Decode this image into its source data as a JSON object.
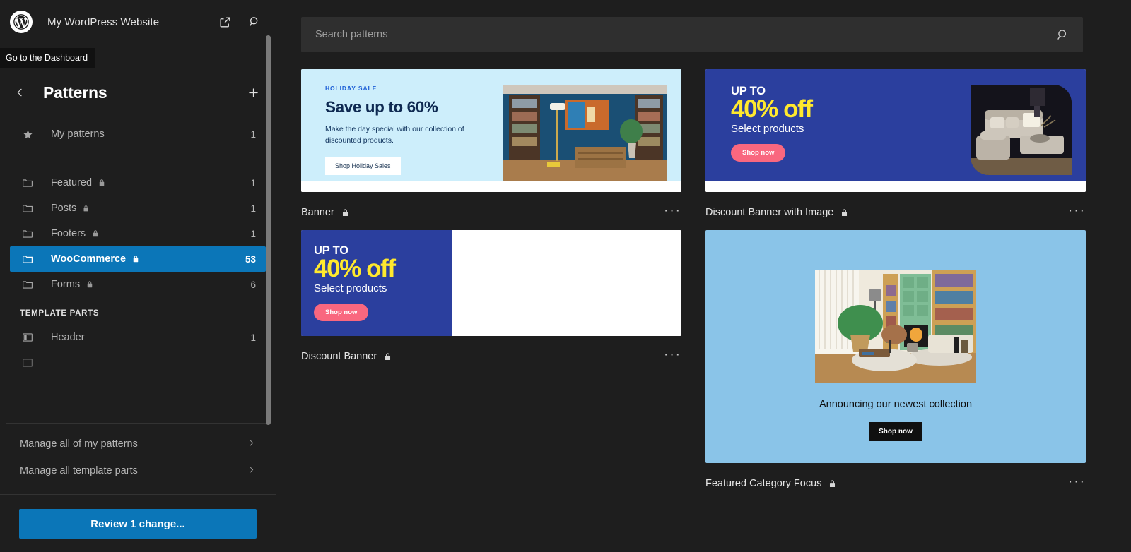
{
  "sidebar": {
    "site_title": "My WordPress Website",
    "logo_icon": "wordpress-logo-icon",
    "view_site_icon": "external-link-icon",
    "search_icon": "search-icon",
    "tooltip": "Go to the Dashboard",
    "panel_title": "Patterns",
    "back_icon": "chevron-left-icon",
    "add_icon": "plus-icon",
    "my_patterns": {
      "label": "My patterns",
      "count": "1",
      "icon": "star-icon"
    },
    "categories": [
      {
        "label": "Featured",
        "count": "1",
        "icon": "folder-icon",
        "locked": true
      },
      {
        "label": "Posts",
        "count": "1",
        "icon": "folder-icon",
        "locked": true
      },
      {
        "label": "Footers",
        "count": "1",
        "icon": "folder-icon",
        "locked": true
      },
      {
        "label": "WooCommerce",
        "count": "53",
        "icon": "folder-icon",
        "locked": true,
        "selected": true
      },
      {
        "label": "Forms",
        "count": "6",
        "icon": "folder-icon",
        "locked": true
      }
    ],
    "template_parts_label": "TEMPLATE PARTS",
    "template_parts": [
      {
        "label": "Header",
        "count": "1",
        "icon": "template-part-icon"
      }
    ],
    "footer_links": [
      {
        "label": "Manage all of my patterns",
        "icon": "chevron-right-icon"
      },
      {
        "label": "Manage all template parts",
        "icon": "chevron-right-icon"
      }
    ],
    "review_button": "Review 1 change..."
  },
  "search": {
    "placeholder": "Search patterns",
    "value": "",
    "icon": "search-icon"
  },
  "patterns": [
    {
      "name": "Banner",
      "locked": true,
      "lock_icon": "lock-icon",
      "menu_icon": "ellipsis-icon",
      "preview": {
        "kicker": "HOLIDAY SALE",
        "headline": "Save up to 60%",
        "subtext": "Make the day special with our collection of discounted products.",
        "button": "Shop Holiday Sales",
        "bg_color": "#cdeefb",
        "accent_color": "#1d5fd6"
      }
    },
    {
      "name": "Discount Banner with Image",
      "locked": true,
      "lock_icon": "lock-icon",
      "menu_icon": "ellipsis-icon",
      "preview": {
        "upto": "UP TO",
        "percent": "40% off",
        "select": "Select products",
        "button": "Shop now",
        "bg_color": "#2b3f9e",
        "accent_color": "#ffe92e",
        "button_color": "#f9677f"
      }
    },
    {
      "name": "Discount Banner",
      "locked": true,
      "lock_icon": "lock-icon",
      "menu_icon": "ellipsis-icon",
      "preview": {
        "upto": "UP TO",
        "percent": "40% off",
        "select": "Select products",
        "button": "Shop now",
        "bg_color": "#2b3f9e",
        "accent_color": "#ffe92e",
        "button_color": "#f9677f"
      }
    },
    {
      "name": "Featured Category Focus",
      "locked": true,
      "lock_icon": "lock-icon",
      "menu_icon": "ellipsis-icon",
      "preview": {
        "caption": "Announcing our newest collection",
        "button": "Shop now",
        "bg_color": "#8ac4e8"
      }
    }
  ],
  "theme": {
    "selected_color": "#0b76b8",
    "background": "#1e1e1e",
    "panel_background": "#2f2f2f"
  }
}
